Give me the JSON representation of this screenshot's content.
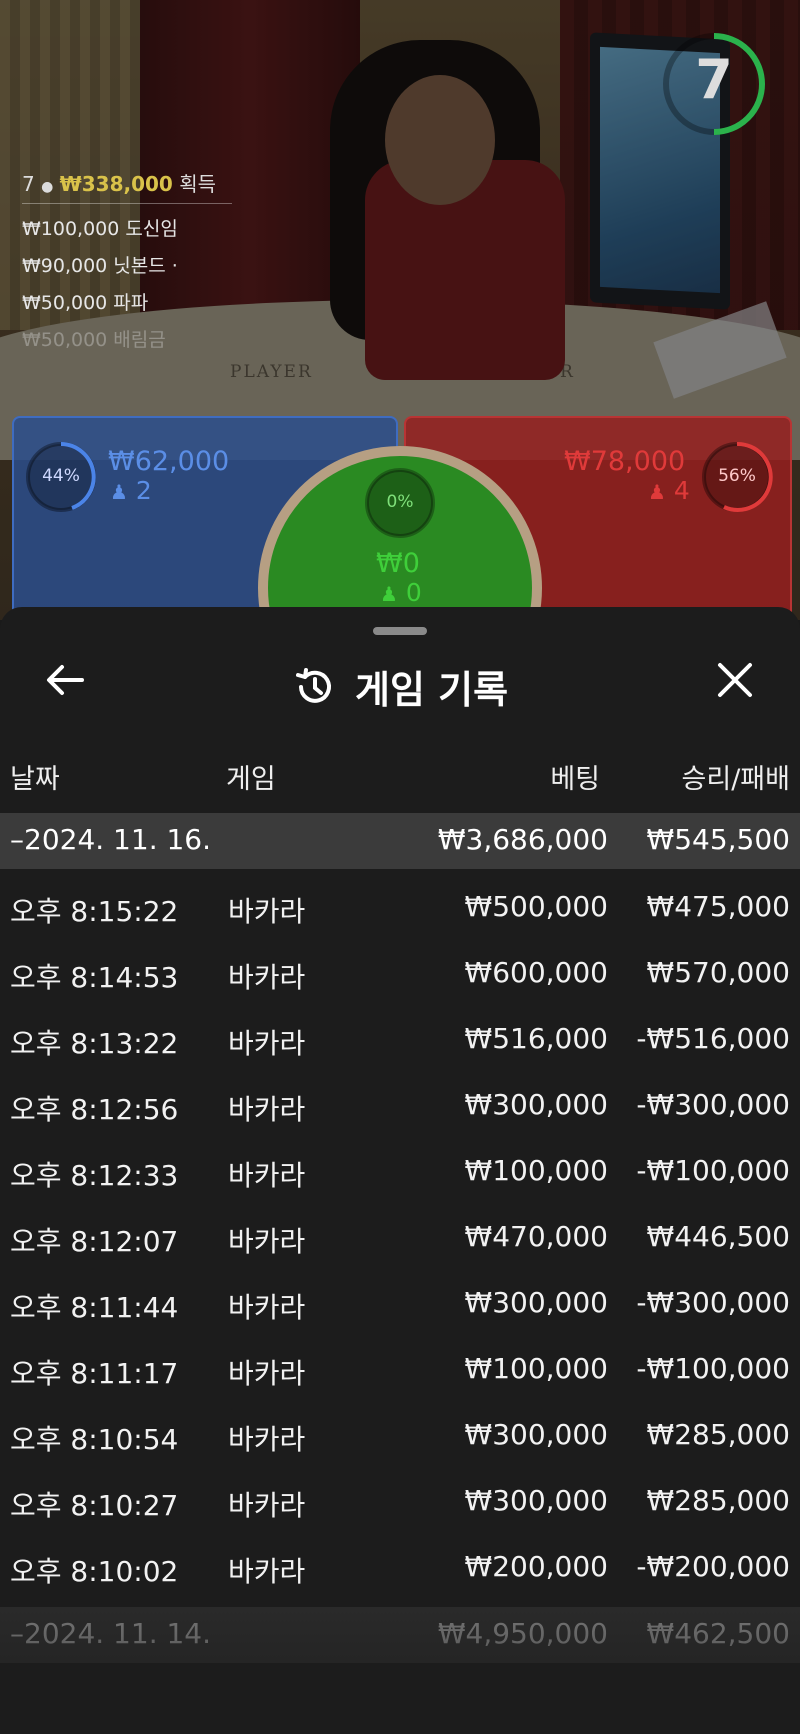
{
  "video": {
    "timer": "7",
    "winners": {
      "head_count": "7",
      "head_amount": "₩338,000",
      "head_suffix": "획득",
      "rows": [
        "₩100,000  도신임",
        "₩90,000  닛본드 ·",
        "₩50,000  파파",
        "₩50,000  배림금"
      ]
    },
    "table_labels": {
      "player": "PLAYER",
      "banker": "R"
    },
    "bets": {
      "player": {
        "percent": "44%",
        "amount": "₩62,000",
        "count": "2",
        "color": "#5b8ee6"
      },
      "tie": {
        "percent": "0%",
        "amount": "₩0",
        "count": "0",
        "color": "#3fcf3a"
      },
      "banker": {
        "percent": "56%",
        "amount": "₩78,000",
        "count": "4",
        "color": "#e03a3a"
      }
    }
  },
  "sheet": {
    "title": "게임 기록",
    "icons": {
      "back": "arrow-left-icon",
      "history": "history-icon",
      "close": "close-icon"
    },
    "columns": {
      "date": "날짜",
      "game": "게임",
      "bet": "베팅",
      "result": "승리/패배"
    },
    "groups": [
      {
        "date": "–2024. 11. 16.",
        "bet": "₩3,686,000",
        "result": "₩545,500",
        "rows": [
          {
            "time": "오후 8:15:22",
            "game": "바카라",
            "bet": "₩500,000",
            "result": "₩475,000"
          },
          {
            "time": "오후 8:14:53",
            "game": "바카라",
            "bet": "₩600,000",
            "result": "₩570,000"
          },
          {
            "time": "오후 8:13:22",
            "game": "바카라",
            "bet": "₩516,000",
            "result": "-₩516,000"
          },
          {
            "time": "오후 8:12:56",
            "game": "바카라",
            "bet": "₩300,000",
            "result": "-₩300,000"
          },
          {
            "time": "오후 8:12:33",
            "game": "바카라",
            "bet": "₩100,000",
            "result": "-₩100,000"
          },
          {
            "time": "오후 8:12:07",
            "game": "바카라",
            "bet": "₩470,000",
            "result": "₩446,500"
          },
          {
            "time": "오후 8:11:44",
            "game": "바카라",
            "bet": "₩300,000",
            "result": "-₩300,000"
          },
          {
            "time": "오후 8:11:17",
            "game": "바카라",
            "bet": "₩100,000",
            "result": "-₩100,000"
          },
          {
            "time": "오후 8:10:54",
            "game": "바카라",
            "bet": "₩300,000",
            "result": "₩285,000"
          },
          {
            "time": "오후 8:10:27",
            "game": "바카라",
            "bet": "₩300,000",
            "result": "₩285,000"
          },
          {
            "time": "오후 8:10:02",
            "game": "바카라",
            "bet": "₩200,000",
            "result": "-₩200,000"
          }
        ]
      },
      {
        "date": "–2024. 11. 14.",
        "bet": "₩4,950,000",
        "result": "₩462,500",
        "rows": []
      }
    ]
  }
}
